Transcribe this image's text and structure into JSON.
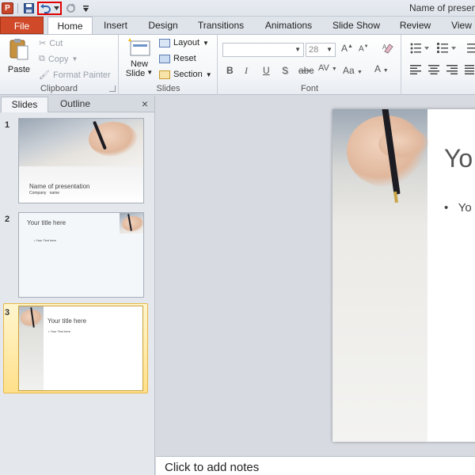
{
  "app": {
    "title": "Name of presen",
    "icon_letter": "P"
  },
  "tabs": [
    "File",
    "Home",
    "Insert",
    "Design",
    "Transitions",
    "Animations",
    "Slide Show",
    "Review",
    "View"
  ],
  "ribbon": {
    "clipboard": {
      "paste": "Paste",
      "cut": "Cut",
      "copy": "Copy",
      "format_painter": "Format Painter",
      "label": "Clipboard"
    },
    "slides": {
      "new_slide_1": "New",
      "new_slide_2": "Slide",
      "layout": "Layout",
      "reset": "Reset",
      "section": "Section",
      "label": "Slides"
    },
    "font": {
      "size": "28",
      "label": "Font",
      "bold": "B",
      "italic": "I",
      "underline": "U",
      "shadow": "S",
      "strike": "abc",
      "spacing": "AV",
      "case": "Aa",
      "color": "A"
    }
  },
  "pane": {
    "tab_slides": "Slides",
    "tab_outline": "Outline",
    "close": "×"
  },
  "thumbnails": [
    {
      "num": "1",
      "title": "Name of presentation",
      "subtitle": "Company   name"
    },
    {
      "num": "2",
      "title": "Your title here",
      "bullet": "Your Text here"
    },
    {
      "num": "3",
      "title": "Your title here",
      "bullet": "Your Text here"
    }
  ],
  "main_slide": {
    "title": "Yo",
    "bullet": "Yo"
  },
  "notes": {
    "placeholder": "Click to add notes"
  },
  "colors": {
    "file_tab": "#d04a2a",
    "highlight_box": "#e00000",
    "selected_thumb": "#ffe08a"
  }
}
